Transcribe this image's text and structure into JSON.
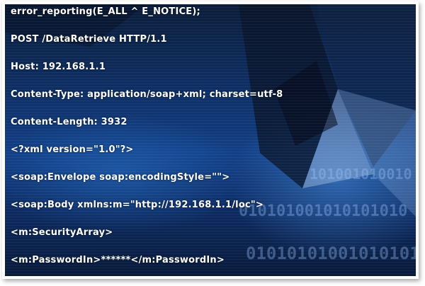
{
  "code_lines": [
    "error_reporting(E_ALL ^ E_NOTICE);",
    "POST /DataRetrieve HTTP/1.1",
    "Host: 192.168.1.1",
    "Content-Type: application/soap+xml; charset=utf-8",
    "Content-Length: 3932",
    "<?xml version=\"1.0\"?>",
    "<soap:Envelope soap:encodingStyle=\"\">",
    "<soap:Body xmlns:m=\"http://192.168.1.1/loc\">",
    "<m:SecurityArray>",
    "<m:PasswordIn>******</m:PasswordIn>"
  ],
  "binary_overlay": [
    "101001010010",
    "010101001010101010",
    "01010101001010101"
  ],
  "colors": {
    "background_dark": "#081a3a",
    "background_blue": "#123f86",
    "text": "#ffffff"
  }
}
